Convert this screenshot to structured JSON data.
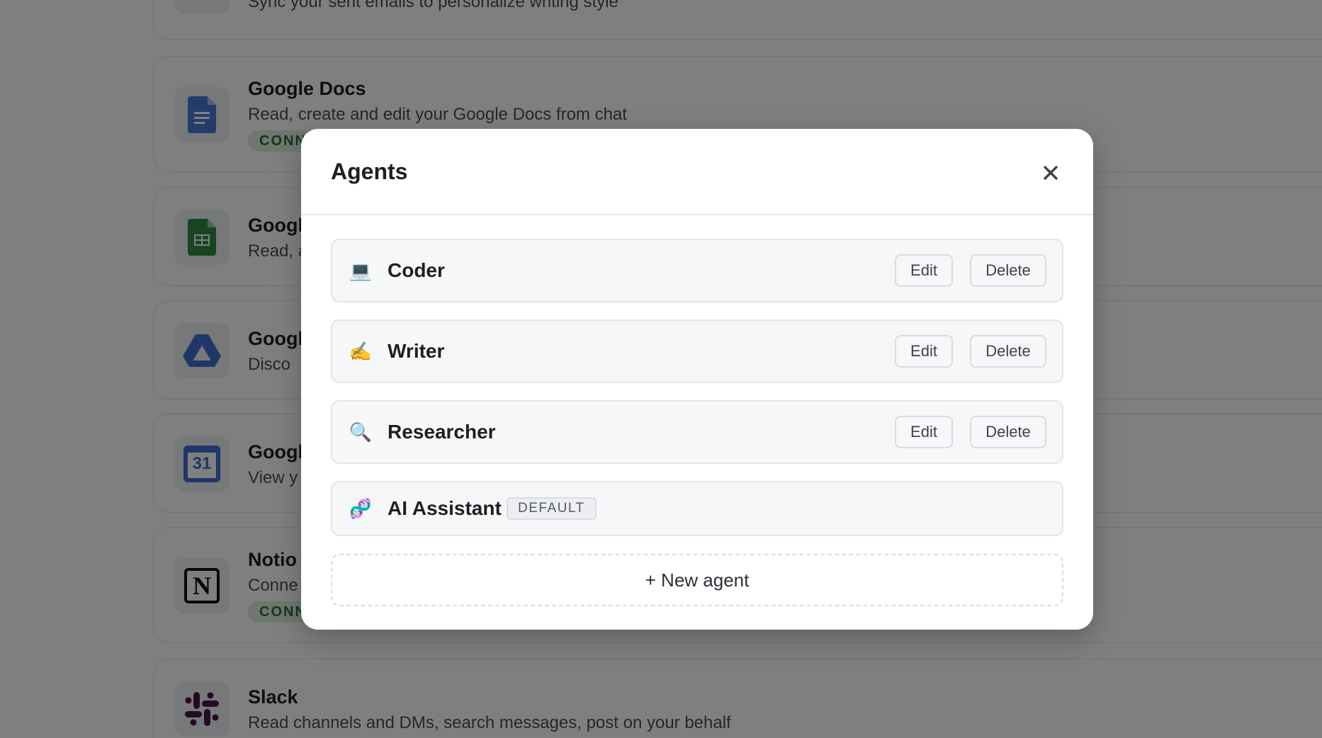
{
  "background": {
    "integrations": [
      {
        "key": "gmail",
        "title": "",
        "description": "Sync your sent emails to personalize writing style",
        "status": ""
      },
      {
        "key": "google-docs",
        "title": "Google Docs",
        "description": "Read, create and edit your Google Docs from chat",
        "status": "CONN"
      },
      {
        "key": "google-sheets",
        "title": "Googl",
        "description": "Read, a",
        "status": ""
      },
      {
        "key": "google-drive",
        "title": "Googl",
        "description": "Disco",
        "status": ""
      },
      {
        "key": "google-calendar",
        "title": "Googl",
        "description": "View y",
        "status": ""
      },
      {
        "key": "notion",
        "title": "Notio",
        "description": "Conne",
        "status": "CONN"
      },
      {
        "key": "slack",
        "title": "Slack",
        "description": "Read channels and DMs, search messages, post on your behalf",
        "status": ""
      }
    ],
    "calendar_icon_text": "31",
    "notion_icon_text": "N"
  },
  "modal": {
    "title": "Agents",
    "close_label": "✕",
    "agents": [
      {
        "name": "Coder",
        "emoji": "💻",
        "edit_label": "Edit",
        "delete_label": "Delete"
      },
      {
        "name": "Writer",
        "emoji": "✍️",
        "edit_label": "Edit",
        "delete_label": "Delete"
      },
      {
        "name": "Researcher",
        "emoji": "🔍",
        "edit_label": "Edit",
        "delete_label": "Delete"
      },
      {
        "name": "AI Assistant",
        "emoji": "🧬",
        "badge": "DEFAULT"
      }
    ],
    "new_agent_label": "+ New agent"
  },
  "colors": {
    "overlay": "#000000",
    "docs_blue": "#4a78d6",
    "sheets_green": "#2e8b45",
    "connected_green": "#2f6b35",
    "slack_aubergine": "#4a154b"
  }
}
